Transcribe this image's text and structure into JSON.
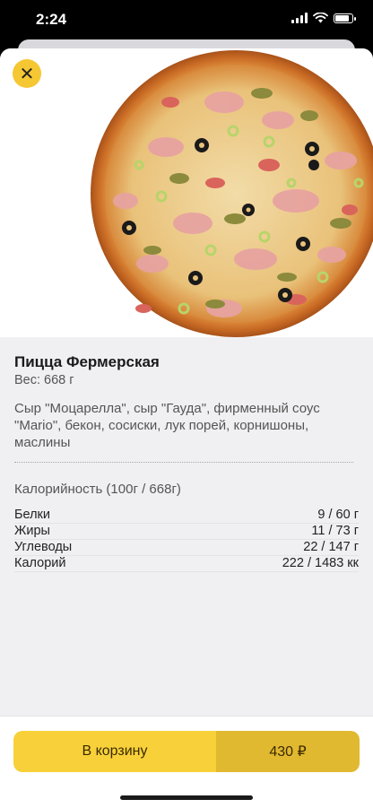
{
  "status_bar": {
    "time": "2:24",
    "icons": [
      "cellular-signal-icon",
      "wifi-icon",
      "battery-icon"
    ]
  },
  "product": {
    "close_icon": "✕",
    "title": "Пицца Фермерская",
    "weight_label": "Вес:",
    "weight_value": "668 г",
    "description": "Сыр \"Моцарелла\", сыр \"Гауда\", фирменный соус \"Mario\", бекон, сосиски, лук порей, корнишоны, маслины",
    "calories_heading": "Калорийность (100г / 668г)",
    "nutrition": [
      {
        "label": "Белки",
        "value": "9 / 60 г"
      },
      {
        "label": "Жиры",
        "value": "11 / 73 г"
      },
      {
        "label": "Углеводы",
        "value": "22 / 147 г"
      },
      {
        "label": "Калорий",
        "value": "222 / 1483 кк"
      }
    ]
  },
  "footer": {
    "cart_label": "В корзину",
    "price": "430 ₽"
  },
  "colors": {
    "accent": "#f8d13a",
    "accent_dark": "#e1b930",
    "sheet_bg": "#f0f0f2"
  }
}
